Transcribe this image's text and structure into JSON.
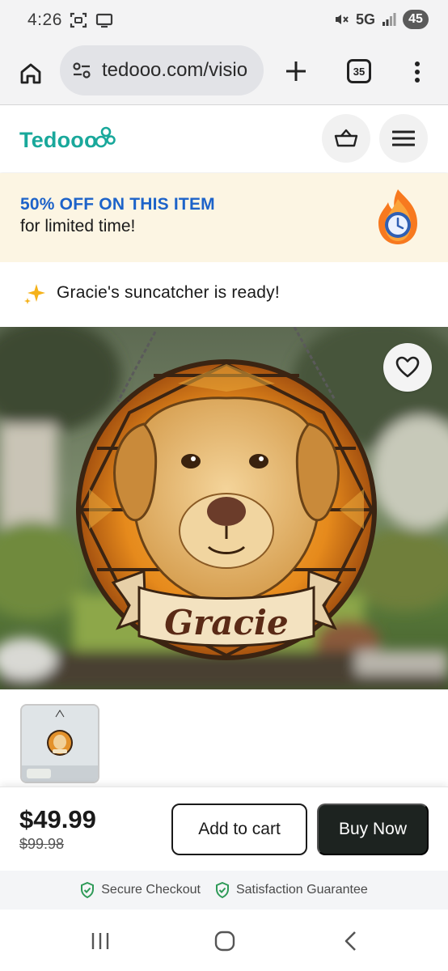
{
  "status_bar": {
    "time": "4:26",
    "network": "5G",
    "battery": "45"
  },
  "browser": {
    "url": "tedooo.com/visio",
    "tab_count": "35"
  },
  "site": {
    "logo_text": "Tedooo"
  },
  "promo": {
    "title": "50% OFF ON THIS ITEM",
    "subtitle": "for limited time!"
  },
  "ready_message": "Gracie's suncatcher is ready!",
  "product": {
    "name_on_banner": "Gracie",
    "price": "$49.99",
    "old_price": "$99.98"
  },
  "actions": {
    "add_to_cart": "Add to cart",
    "buy_now": "Buy Now"
  },
  "trust": {
    "secure": "Secure Checkout",
    "guarantee": "Satisfaction Guarantee"
  },
  "colors": {
    "brand_teal": "#19a89b",
    "promo_blue": "#1d63c9",
    "promo_bg": "#fcf5e3",
    "buy_now_bg": "#1d2320",
    "trust_green": "#2e9a57"
  }
}
